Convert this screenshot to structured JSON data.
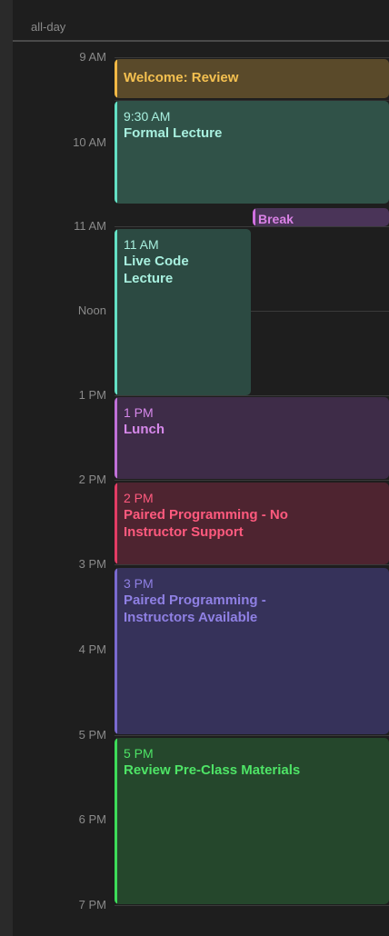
{
  "allday_label": "all-day",
  "time_labels": [
    "9 AM",
    "10 AM",
    "11 AM",
    "Noon",
    "1 PM",
    "2 PM",
    "3 PM",
    "4 PM",
    "5 PM",
    "6 PM",
    "7 PM"
  ],
  "events": {
    "welcome": {
      "title": "Welcome: Review"
    },
    "formal_lecture": {
      "time": "9:30 AM",
      "title": "Formal Lecture"
    },
    "break": {
      "title": "Break"
    },
    "live_code": {
      "time": "11 AM",
      "title": "Live Code Lecture"
    },
    "lunch": {
      "time": "1 PM",
      "title": "Lunch"
    },
    "paired_no_support": {
      "time": "2 PM",
      "title": "Paired Programming - No Instructor Support"
    },
    "paired_instructors": {
      "time": "3 PM",
      "title": "Paired Programming - Instructors Available"
    },
    "review_preclass": {
      "time": "5 PM",
      "title": "Review Pre-Class Materials"
    }
  },
  "colors": {
    "welcome": "#f2b844",
    "lecture": "#63e0c4",
    "break": "#d070e0",
    "lunch": "#c070d8",
    "paired_no_support": "#e23c64",
    "paired_instructors": "#7a6ad0",
    "review": "#3ddc58"
  }
}
